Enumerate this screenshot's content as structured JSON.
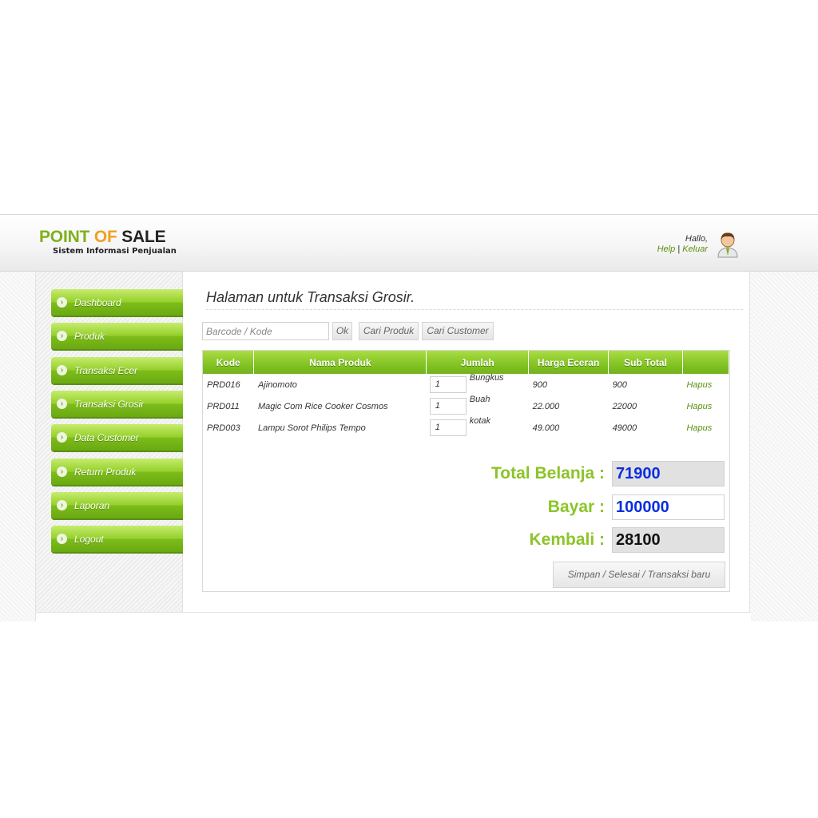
{
  "header": {
    "logo_part1": "POINT",
    "logo_part2": "OF",
    "logo_part3": "SALE",
    "subtitle": "Sistem Informasi Penjualan",
    "greeting": "Hallo,",
    "help": "Help",
    "separator": "|",
    "logout": "Keluar"
  },
  "sidebar": {
    "items": [
      {
        "label": "Dashboard"
      },
      {
        "label": "Produk"
      },
      {
        "label": "Transaksi Ecer"
      },
      {
        "label": "Transaksi Grosir"
      },
      {
        "label": "Data Customer"
      },
      {
        "label": "Return Produk"
      },
      {
        "label": "Laporan"
      },
      {
        "label": "Logout"
      }
    ]
  },
  "main": {
    "title": "Halaman untuk Transaksi Grosir.",
    "search": {
      "placeholder": "Barcode / Kode",
      "ok": "Ok",
      "find_product": "Cari Produk",
      "find_customer": "Cari Customer"
    },
    "table": {
      "headers": [
        "Kode",
        "Nama Produk",
        "Jumlah",
        "Harga Eceran",
        "Sub Total",
        ""
      ],
      "rows": [
        {
          "kode": "PRD016",
          "nama": "Ajinomoto",
          "jumlah": "1",
          "satuan": "Bungkus",
          "harga": "900",
          "subtotal": "900",
          "action": "Hapus"
        },
        {
          "kode": "PRD011",
          "nama": "Magic Com Rice Cooker Cosmos",
          "jumlah": "1",
          "satuan": "Buah",
          "harga": "22.000",
          "subtotal": "22000",
          "action": "Hapus"
        },
        {
          "kode": "PRD003",
          "nama": "Lampu Sorot Philips Tempo",
          "jumlah": "1",
          "satuan": "kotak",
          "harga": "49.000",
          "subtotal": "49000",
          "action": "Hapus"
        }
      ]
    },
    "summary": {
      "total_label": "Total Belanja :",
      "total_value": "71900",
      "bayar_label": "Bayar :",
      "bayar_value": "100000",
      "kembali_label": "Kembali :",
      "kembali_value": "28100",
      "save_label": "Simpan / Selesai / Transaksi baru"
    }
  },
  "colors": {
    "accent_green": "#8cc428",
    "value_blue": "#0a2ee0"
  }
}
